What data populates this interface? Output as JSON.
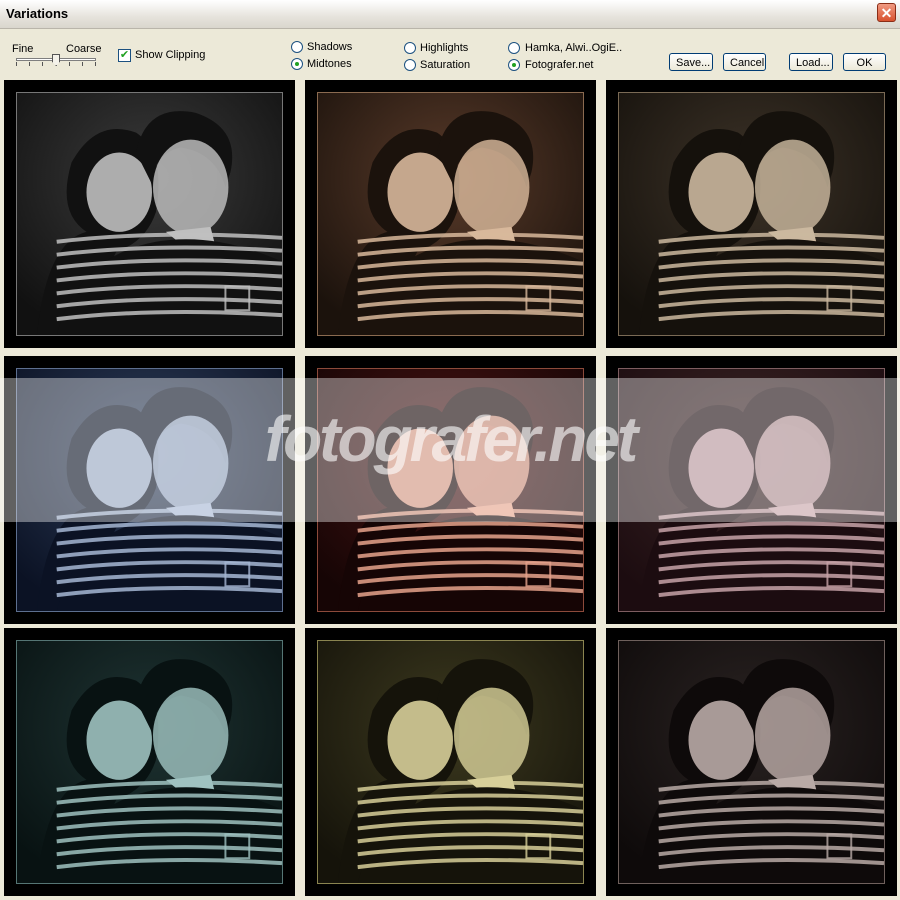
{
  "window": {
    "title": "Variations"
  },
  "coarseness": {
    "fine_label": "Fine",
    "coarse_label": "Coarse",
    "level": 0.5
  },
  "show_clipping": {
    "label": "Show Clipping",
    "checked": true
  },
  "range_options": [
    {
      "label": "Shadows",
      "selected": false
    },
    {
      "label": "Midtones",
      "selected": true
    },
    {
      "label": "Highlights",
      "selected": false
    },
    {
      "label": "Saturation",
      "selected": false
    }
  ],
  "preset_options": [
    {
      "label": "Hamka, Alwi..OgiE..",
      "selected": false
    },
    {
      "label": "Fotografer.net",
      "selected": true
    }
  ],
  "buttons": {
    "save": "Save...",
    "cancel": "Cancel",
    "load": "Load...",
    "ok": "OK"
  },
  "watermark": "fotografer.net",
  "variations": [
    {
      "name": "original",
      "bg": "#3b3b3b",
      "tint": "#bfbfbf",
      "dark": "#111111",
      "frame": "#777777"
    },
    {
      "name": "more-yellow-red",
      "bg": "#5a3b2a",
      "tint": "#d8b89b",
      "dark": "#1b120c",
      "frame": "#8a6a50"
    },
    {
      "name": "sepia",
      "bg": "#3d3328",
      "tint": "#cbb89f",
      "dark": "#15110c",
      "frame": "#7a6a55"
    },
    {
      "name": "more-blue",
      "bg": "#2f3f5c",
      "tint": "#a6b7d3",
      "dark": "#0b1224",
      "frame": "#5d6f8f"
    },
    {
      "name": "more-red",
      "bg": "#4a1414",
      "tint": "#e6a38c",
      "dark": "#160505",
      "frame": "#8b4a3a"
    },
    {
      "name": "more-magenta",
      "bg": "#3c2525",
      "tint": "#c7a3a8",
      "dark": "#1c0c10",
      "frame": "#7d5d60"
    },
    {
      "name": "more-cyan",
      "bg": "#1f3433",
      "tint": "#9fc2c0",
      "dark": "#081212",
      "frame": "#557574"
    },
    {
      "name": "more-yellow",
      "bg": "#3d3a1f",
      "tint": "#d7cf99",
      "dark": "#15130a",
      "frame": "#8a8450"
    },
    {
      "name": "darker",
      "bg": "#2a2322",
      "tint": "#b9aaa6",
      "dark": "#0e0a0a",
      "frame": "#6e605c"
    }
  ]
}
